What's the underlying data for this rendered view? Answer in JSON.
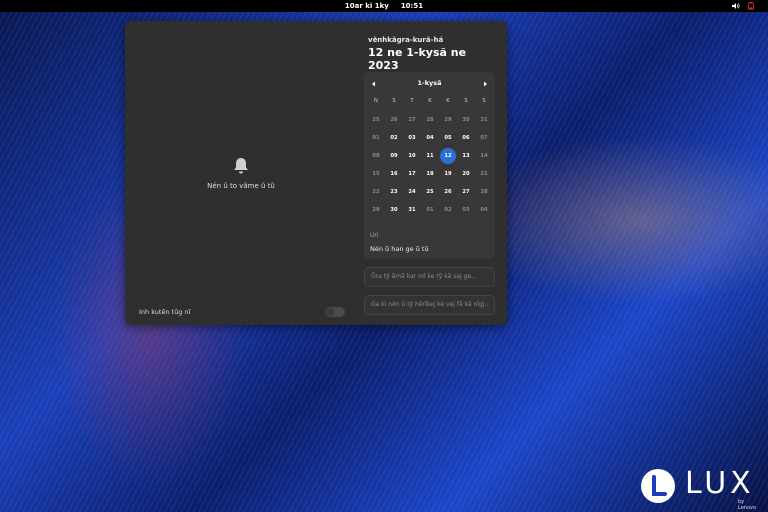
{
  "topbar": {
    "date": "10ar ki 1ky",
    "time": "10:51",
    "icons": [
      "volume-icon",
      "battery-icon"
    ]
  },
  "notifications": {
    "empty_text": "Nén ũ to vãme ũ tũ",
    "dnd_label": "Inh kutẽn tũg nĩ",
    "dnd_enabled": false
  },
  "calendar": {
    "weekday": "vẽnhkãgra-kurã-há",
    "full_date": "12 ne 1-kysã ne 2023",
    "month_label": "1-kysã",
    "day_headers": [
      "N",
      "S",
      "T",
      "K",
      "K",
      "S",
      "S"
    ],
    "weeks": [
      [
        {
          "d": "25",
          "dim": true
        },
        {
          "d": "26",
          "dim": true
        },
        {
          "d": "27",
          "dim": true
        },
        {
          "d": "28",
          "dim": true
        },
        {
          "d": "29",
          "dim": true
        },
        {
          "d": "30",
          "dim": true
        },
        {
          "d": "31",
          "dim": true
        }
      ],
      [
        {
          "d": "01",
          "dim": true
        },
        {
          "d": "02",
          "dim": false
        },
        {
          "d": "03",
          "dim": false
        },
        {
          "d": "04",
          "dim": false
        },
        {
          "d": "05",
          "dim": false
        },
        {
          "d": "06",
          "dim": false
        },
        {
          "d": "07",
          "dim": true
        }
      ],
      [
        {
          "d": "08",
          "dim": true
        },
        {
          "d": "09",
          "dim": false
        },
        {
          "d": "10",
          "dim": false
        },
        {
          "d": "11",
          "dim": false
        },
        {
          "d": "12",
          "dim": false,
          "today": true
        },
        {
          "d": "13",
          "dim": false
        },
        {
          "d": "14",
          "dim": true
        }
      ],
      [
        {
          "d": "15",
          "dim": true
        },
        {
          "d": "16",
          "dim": false
        },
        {
          "d": "17",
          "dim": false
        },
        {
          "d": "18",
          "dim": false
        },
        {
          "d": "19",
          "dim": false
        },
        {
          "d": "20",
          "dim": false
        },
        {
          "d": "21",
          "dim": true
        }
      ],
      [
        {
          "d": "22",
          "dim": true
        },
        {
          "d": "23",
          "dim": false
        },
        {
          "d": "24",
          "dim": false
        },
        {
          "d": "25",
          "dim": false
        },
        {
          "d": "26",
          "dim": false
        },
        {
          "d": "27",
          "dim": false
        },
        {
          "d": "28",
          "dim": true
        }
      ],
      [
        {
          "d": "29",
          "dim": true
        },
        {
          "d": "30",
          "dim": false
        },
        {
          "d": "31",
          "dim": false
        },
        {
          "d": "01",
          "dim": true
        },
        {
          "d": "02",
          "dim": true
        },
        {
          "d": "03",
          "dim": true
        },
        {
          "d": "04",
          "dim": true
        }
      ]
    ],
    "today_color": "#2f6fd8"
  },
  "world_clocks": {
    "title": "Uri",
    "description": "Nén ũ han ge ũ tũ"
  },
  "weather_entry": "Õra tỹ ãmã kar mĩ ke tỹ kã saj ge...",
  "location_entry": "Ga ki nén ũ tỹ hẽrĩkej ke vej fã kã nĩgj...",
  "brand": {
    "name": "LUX",
    "sub": "by Lenovo"
  }
}
